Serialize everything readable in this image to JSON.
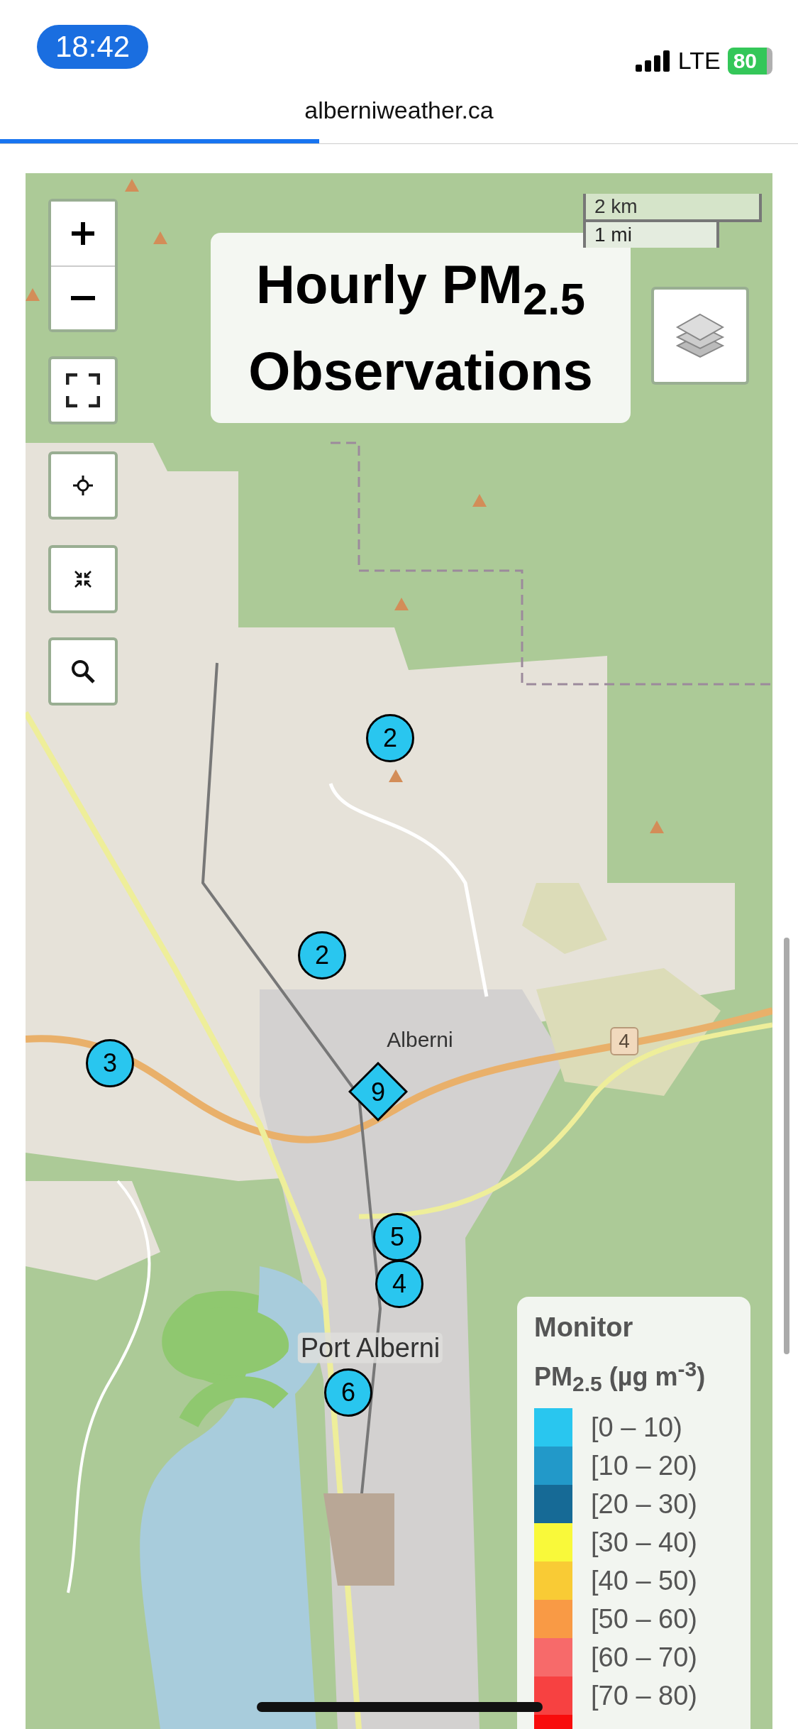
{
  "status_bar": {
    "time": "18:42",
    "network": "LTE",
    "battery": "80"
  },
  "browser": {
    "url": "alberniweather.ca",
    "load_progress": {
      "level": 0.4
    }
  },
  "map": {
    "title": "Hourly PM$_{2.5}$\nObservations",
    "scale": [
      "2 km",
      "1 mi"
    ],
    "place_labels": [
      {
        "text": "Alberni",
        "kind": "town"
      },
      {
        "text": "4",
        "kind": "highway"
      },
      {
        "text": "Port Alberni",
        "kind": "town"
      }
    ],
    "monitors": [
      {
        "value": "2",
        "kind": "circle",
        "color": "#29c6ef"
      },
      {
        "value": "2",
        "kind": "circle",
        "color": "#29c6ef"
      },
      {
        "value": "3",
        "kind": "circle",
        "color": "#29c6ef"
      },
      {
        "value": "9",
        "kind": "diamond",
        "color": "#29c6ef"
      },
      {
        "value": "5",
        "kind": "circle",
        "color": "#29c6ef"
      },
      {
        "value": "4",
        "kind": "circle",
        "color": "#29c6ef"
      },
      {
        "value": "6",
        "kind": "circle",
        "color": "#29c6ef"
      }
    ],
    "legend": {
      "title": "Monitor",
      "unit": "PM$_{2.5}$ (µg m$^{-3}$)",
      "items": [
        {
          "label": "[0 – 10)",
          "color": "#29c6ef"
        },
        {
          "label": "[10 – 20)",
          "color": "#2299c9"
        },
        {
          "label": "[20 – 30)",
          "color": "#166a96"
        },
        {
          "label": "[30 – 40)",
          "color": "#f9f93a"
        },
        {
          "label": "[40 – 50)",
          "color": "#f9cb35"
        },
        {
          "label": "[50 – 60)",
          "color": "#f99a45"
        },
        {
          "label": "[60 – 70)",
          "color": "#f76a6a"
        },
        {
          "label": "[70 – 80)",
          "color": "#f74141"
        },
        {
          "color": "#f80c0c"
        }
      ]
    }
  }
}
